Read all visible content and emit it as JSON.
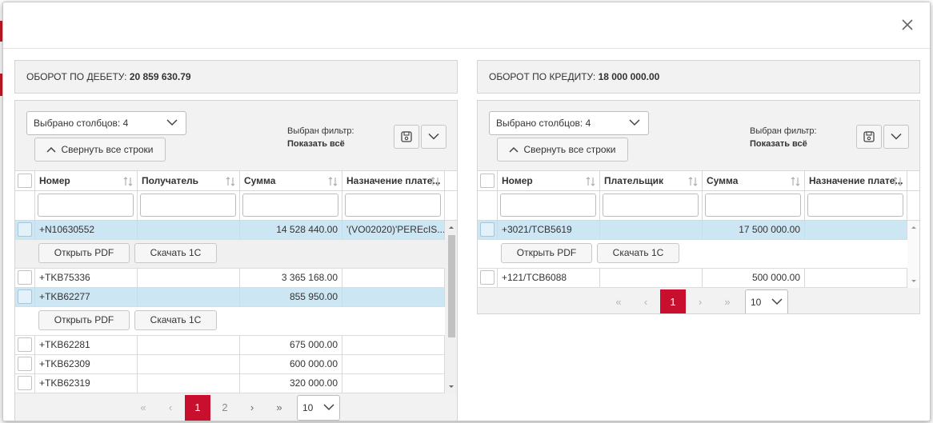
{
  "debit": {
    "summary_label": "ОБОРОТ ПО ДЕБЕТУ:",
    "summary_value": "20 859 630.79",
    "columns_selected": "Выбрано столбцов: 4",
    "collapse_label": "Свернуть все строки",
    "filter_label": "Выбран фильтр:",
    "filter_value": "Показать всё",
    "headers": [
      "Номер",
      "Получатель",
      "Сумма",
      "Назначение плате..."
    ],
    "rows": [
      {
        "number": "+N10630552",
        "party": "",
        "amount": "14 528 440.00",
        "purpose": "'(VO02020)'PEREcIS...",
        "selected": true
      },
      {
        "number": "+TKB75336",
        "party": "",
        "amount": "3 365 168.00",
        "purpose": ""
      },
      {
        "number": "+TKB62277",
        "party": "",
        "amount": "855 950.00",
        "purpose": "",
        "selected": true
      },
      {
        "number": "+TKB62281",
        "party": "",
        "amount": "675 000.00",
        "purpose": ""
      },
      {
        "number": "+TKB62309",
        "party": "",
        "amount": "600 000.00",
        "purpose": ""
      },
      {
        "number": "+TKB62319",
        "party": "",
        "amount": "320 000.00",
        "purpose": ""
      }
    ],
    "open_pdf": "Открыть PDF",
    "download_1c": "Скачать 1С",
    "pages": [
      "1",
      "2"
    ],
    "page_size": "10"
  },
  "credit": {
    "summary_label": "ОБОРОТ ПО КРЕДИТУ:",
    "summary_value": "18 000 000.00",
    "columns_selected": "Выбрано столбцов: 4",
    "collapse_label": "Свернуть все строки",
    "filter_label": "Выбран фильтр:",
    "filter_value": "Показать всё",
    "headers": [
      "Номер",
      "Плательщик",
      "Сумма",
      "Назначение плате..."
    ],
    "rows": [
      {
        "number": "+3021/TCB5619",
        "party": "",
        "amount": "17 500 000.00",
        "purpose": "",
        "selected": true
      },
      {
        "number": "+121/TCB6088",
        "party": "",
        "amount": "500 000.00",
        "purpose": ""
      }
    ],
    "open_pdf": "Открыть PDF",
    "download_1c": "Скачать 1С",
    "pages": [
      "1"
    ],
    "page_size": "10"
  },
  "pager_glyphs": {
    "first": "«",
    "prev": "‹",
    "next": "›",
    "last": "»"
  },
  "colors": {
    "accent": "#c8102e",
    "selected_row": "#cde6f4"
  }
}
